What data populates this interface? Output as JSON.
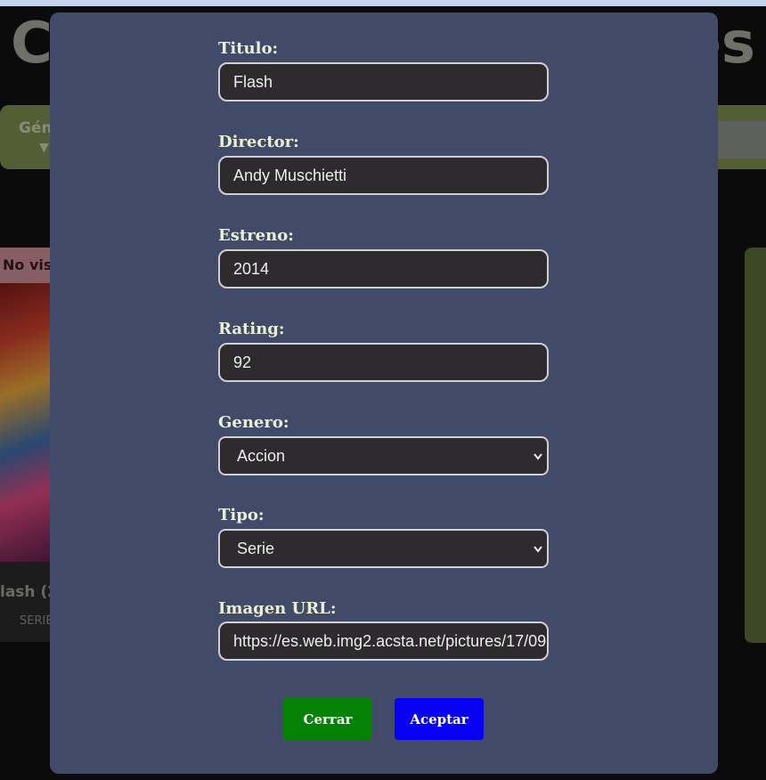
{
  "background": {
    "heading_left": "C",
    "heading_right": "es",
    "filter_label": "Gén",
    "filter_arrow": "▼",
    "card_badge": "No vist",
    "card_title": "lash (2",
    "card_type": "SERIE"
  },
  "modal": {
    "fields": {
      "titulo": {
        "label": "Titulo:",
        "value": "Flash"
      },
      "director": {
        "label": "Director:",
        "value": "Andy Muschietti"
      },
      "estreno": {
        "label": "Estreno:",
        "value": "2014"
      },
      "rating": {
        "label": "Rating:",
        "value": "92"
      },
      "genero": {
        "label": "Genero:",
        "value": "Accion"
      },
      "tipo": {
        "label": "Tipo:",
        "value": "Serie"
      },
      "imagen": {
        "label": "Imagen URL:",
        "value": "https://es.web.img2.acsta.net/pictures/17/09"
      }
    },
    "buttons": {
      "cerrar": "Cerrar",
      "aceptar": "Aceptar"
    }
  },
  "colors": {
    "modal_bg": "#424a69",
    "cerrar_bg": "#058205",
    "aceptar_bg": "#0800f5",
    "label_text": "#eaf0d4",
    "input_bg": "#2d2b2d"
  },
  "icons": {
    "select_chevron": "chevron-down-icon"
  }
}
